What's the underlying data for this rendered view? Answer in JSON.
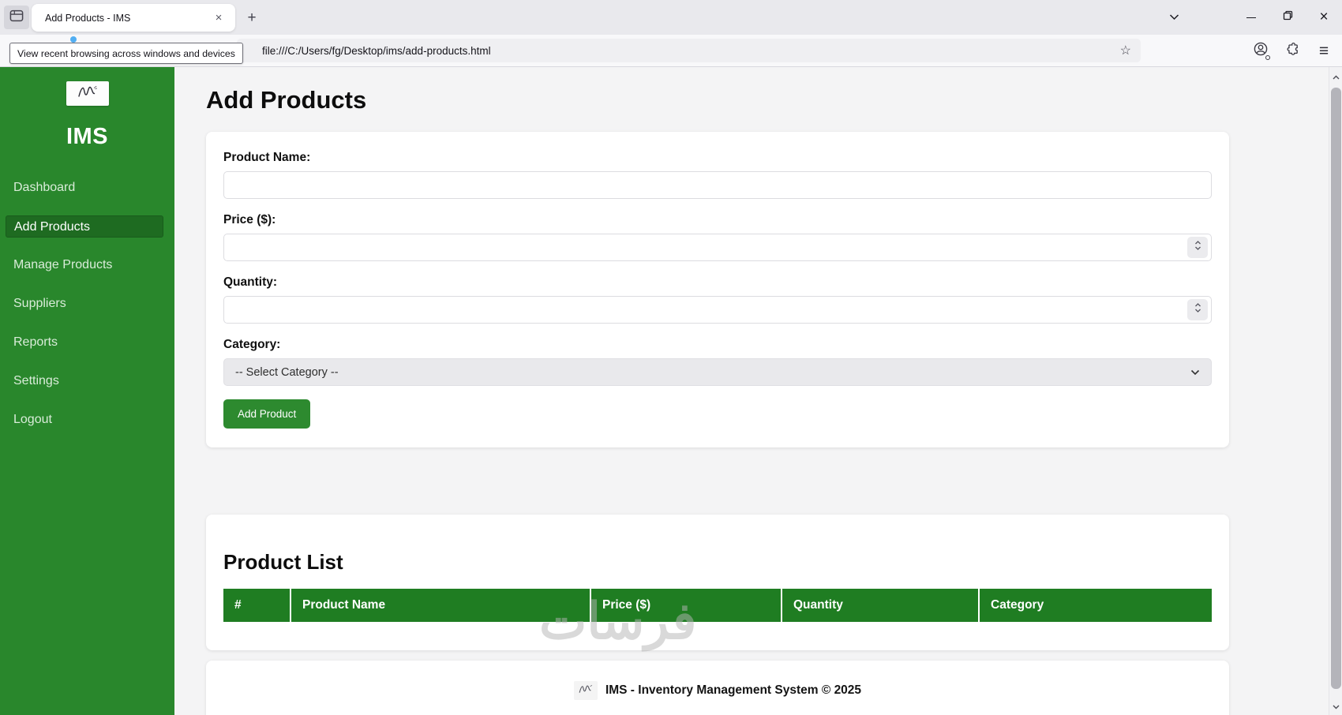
{
  "browser": {
    "tab_title": "Add Products - IMS",
    "tooltip": "View recent browsing across windows and devices",
    "url": "file:///C:/Users/fg/Desktop/ims/add-products.html",
    "icons": {
      "close_tab": "×",
      "new_tab": "+",
      "minimize": "–",
      "close_window": "×",
      "menu": "≡",
      "bookmark_star": "☆"
    }
  },
  "sidebar": {
    "brand": "IMS",
    "items": [
      {
        "label": "Dashboard",
        "active": false
      },
      {
        "label": "Add Products",
        "active": true
      },
      {
        "label": "Manage Products",
        "active": false
      },
      {
        "label": "Suppliers",
        "active": false
      },
      {
        "label": "Reports",
        "active": false
      },
      {
        "label": "Settings",
        "active": false
      },
      {
        "label": "Logout",
        "active": false
      }
    ]
  },
  "main": {
    "page_title": "Add Products",
    "form": {
      "product_name_label": "Product Name:",
      "product_name_value": "",
      "price_label": "Price ($):",
      "price_value": "",
      "quantity_label": "Quantity:",
      "quantity_value": "",
      "category_label": "Category:",
      "category_value": "-- Select Category --",
      "submit_label": "Add Product"
    },
    "product_list": {
      "title": "Product List",
      "columns": [
        "#",
        "Product Name",
        "Price ($)",
        "Quantity",
        "Category"
      ],
      "rows": []
    },
    "footer": {
      "text": "IMS - Inventory Management System © 2025"
    },
    "watermark": "فرسات"
  },
  "colors": {
    "sidebar_green": "#29872c",
    "active_item_green": "#1e6b21",
    "table_header_green": "#1f7d22",
    "button_green": "#2d8a2f"
  }
}
